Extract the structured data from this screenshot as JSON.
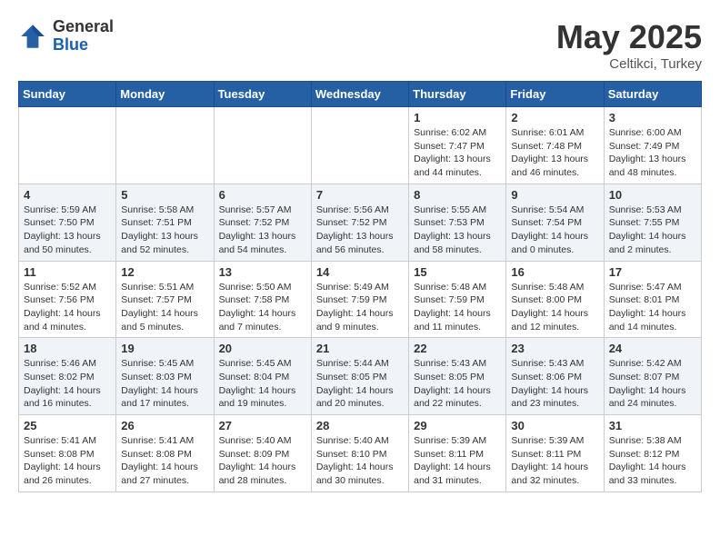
{
  "header": {
    "logo_general": "General",
    "logo_blue": "Blue",
    "title": "May 2025",
    "location": "Celtikci, Turkey"
  },
  "days_of_week": [
    "Sunday",
    "Monday",
    "Tuesday",
    "Wednesday",
    "Thursday",
    "Friday",
    "Saturday"
  ],
  "weeks": [
    [
      {
        "day": "",
        "info": ""
      },
      {
        "day": "",
        "info": ""
      },
      {
        "day": "",
        "info": ""
      },
      {
        "day": "",
        "info": ""
      },
      {
        "day": "1",
        "info": "Sunrise: 6:02 AM\nSunset: 7:47 PM\nDaylight: 13 hours\nand 44 minutes."
      },
      {
        "day": "2",
        "info": "Sunrise: 6:01 AM\nSunset: 7:48 PM\nDaylight: 13 hours\nand 46 minutes."
      },
      {
        "day": "3",
        "info": "Sunrise: 6:00 AM\nSunset: 7:49 PM\nDaylight: 13 hours\nand 48 minutes."
      }
    ],
    [
      {
        "day": "4",
        "info": "Sunrise: 5:59 AM\nSunset: 7:50 PM\nDaylight: 13 hours\nand 50 minutes."
      },
      {
        "day": "5",
        "info": "Sunrise: 5:58 AM\nSunset: 7:51 PM\nDaylight: 13 hours\nand 52 minutes."
      },
      {
        "day": "6",
        "info": "Sunrise: 5:57 AM\nSunset: 7:52 PM\nDaylight: 13 hours\nand 54 minutes."
      },
      {
        "day": "7",
        "info": "Sunrise: 5:56 AM\nSunset: 7:52 PM\nDaylight: 13 hours\nand 56 minutes."
      },
      {
        "day": "8",
        "info": "Sunrise: 5:55 AM\nSunset: 7:53 PM\nDaylight: 13 hours\nand 58 minutes."
      },
      {
        "day": "9",
        "info": "Sunrise: 5:54 AM\nSunset: 7:54 PM\nDaylight: 14 hours\nand 0 minutes."
      },
      {
        "day": "10",
        "info": "Sunrise: 5:53 AM\nSunset: 7:55 PM\nDaylight: 14 hours\nand 2 minutes."
      }
    ],
    [
      {
        "day": "11",
        "info": "Sunrise: 5:52 AM\nSunset: 7:56 PM\nDaylight: 14 hours\nand 4 minutes."
      },
      {
        "day": "12",
        "info": "Sunrise: 5:51 AM\nSunset: 7:57 PM\nDaylight: 14 hours\nand 5 minutes."
      },
      {
        "day": "13",
        "info": "Sunrise: 5:50 AM\nSunset: 7:58 PM\nDaylight: 14 hours\nand 7 minutes."
      },
      {
        "day": "14",
        "info": "Sunrise: 5:49 AM\nSunset: 7:59 PM\nDaylight: 14 hours\nand 9 minutes."
      },
      {
        "day": "15",
        "info": "Sunrise: 5:48 AM\nSunset: 7:59 PM\nDaylight: 14 hours\nand 11 minutes."
      },
      {
        "day": "16",
        "info": "Sunrise: 5:48 AM\nSunset: 8:00 PM\nDaylight: 14 hours\nand 12 minutes."
      },
      {
        "day": "17",
        "info": "Sunrise: 5:47 AM\nSunset: 8:01 PM\nDaylight: 14 hours\nand 14 minutes."
      }
    ],
    [
      {
        "day": "18",
        "info": "Sunrise: 5:46 AM\nSunset: 8:02 PM\nDaylight: 14 hours\nand 16 minutes."
      },
      {
        "day": "19",
        "info": "Sunrise: 5:45 AM\nSunset: 8:03 PM\nDaylight: 14 hours\nand 17 minutes."
      },
      {
        "day": "20",
        "info": "Sunrise: 5:45 AM\nSunset: 8:04 PM\nDaylight: 14 hours\nand 19 minutes."
      },
      {
        "day": "21",
        "info": "Sunrise: 5:44 AM\nSunset: 8:05 PM\nDaylight: 14 hours\nand 20 minutes."
      },
      {
        "day": "22",
        "info": "Sunrise: 5:43 AM\nSunset: 8:05 PM\nDaylight: 14 hours\nand 22 minutes."
      },
      {
        "day": "23",
        "info": "Sunrise: 5:43 AM\nSunset: 8:06 PM\nDaylight: 14 hours\nand 23 minutes."
      },
      {
        "day": "24",
        "info": "Sunrise: 5:42 AM\nSunset: 8:07 PM\nDaylight: 14 hours\nand 24 minutes."
      }
    ],
    [
      {
        "day": "25",
        "info": "Sunrise: 5:41 AM\nSunset: 8:08 PM\nDaylight: 14 hours\nand 26 minutes."
      },
      {
        "day": "26",
        "info": "Sunrise: 5:41 AM\nSunset: 8:08 PM\nDaylight: 14 hours\nand 27 minutes."
      },
      {
        "day": "27",
        "info": "Sunrise: 5:40 AM\nSunset: 8:09 PM\nDaylight: 14 hours\nand 28 minutes."
      },
      {
        "day": "28",
        "info": "Sunrise: 5:40 AM\nSunset: 8:10 PM\nDaylight: 14 hours\nand 30 minutes."
      },
      {
        "day": "29",
        "info": "Sunrise: 5:39 AM\nSunset: 8:11 PM\nDaylight: 14 hours\nand 31 minutes."
      },
      {
        "day": "30",
        "info": "Sunrise: 5:39 AM\nSunset: 8:11 PM\nDaylight: 14 hours\nand 32 minutes."
      },
      {
        "day": "31",
        "info": "Sunrise: 5:38 AM\nSunset: 8:12 PM\nDaylight: 14 hours\nand 33 minutes."
      }
    ]
  ]
}
